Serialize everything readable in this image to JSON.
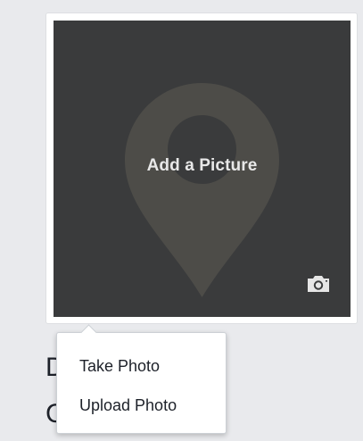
{
  "photo_card": {
    "label": "Add a Picture",
    "icons": {
      "placeholder": "map-pin-icon",
      "camera": "camera-icon"
    }
  },
  "behind_text": [
    "D",
    "C"
  ],
  "menu": {
    "items": [
      {
        "label": "Take Photo"
      },
      {
        "label": "Upload Photo"
      }
    ]
  },
  "colors": {
    "page_background": "#e9eaed",
    "photo_background": "#3a3b3c",
    "pin": "#4d4c48",
    "label": "#e8e8e8",
    "menu_text": "#1d2129"
  }
}
